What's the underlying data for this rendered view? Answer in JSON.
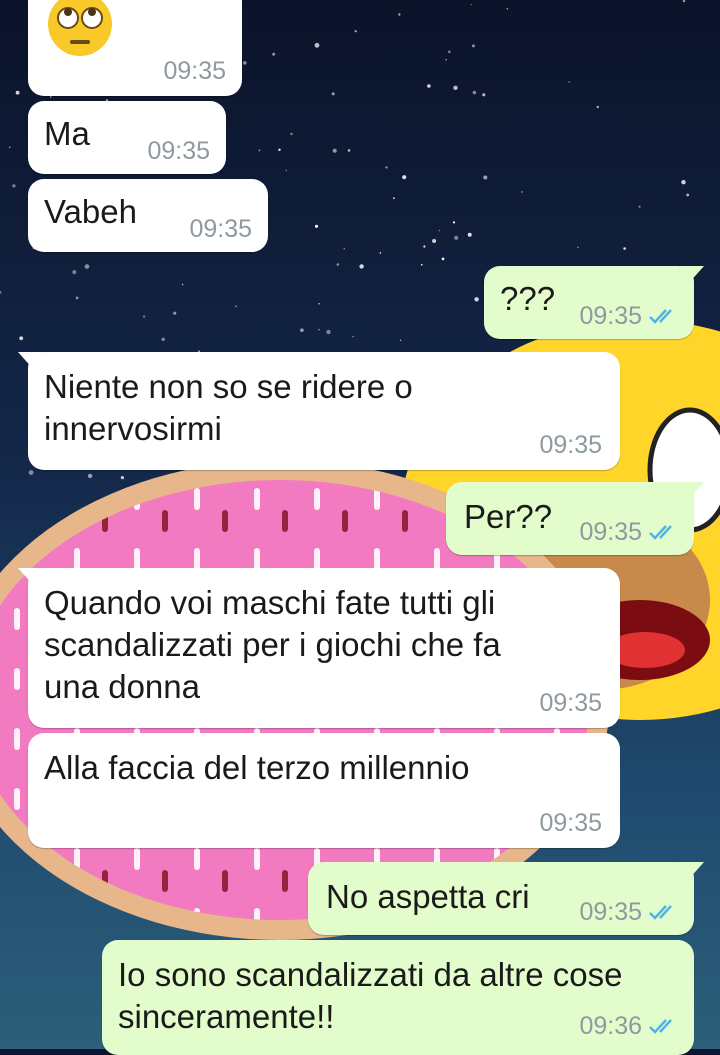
{
  "chat": {
    "messages": [
      {
        "direction": "incoming",
        "text": "🙄",
        "time": "09:35"
      },
      {
        "direction": "incoming",
        "text": "Ma",
        "time": "09:35"
      },
      {
        "direction": "incoming",
        "text": "Vabeh",
        "time": "09:35"
      },
      {
        "direction": "outgoing",
        "text": "???",
        "time": "09:35",
        "status": "read"
      },
      {
        "direction": "incoming",
        "text": "Niente non so se ridere o\ninnervosirmi",
        "time": "09:35"
      },
      {
        "direction": "outgoing",
        "text": "Per??",
        "time": "09:35",
        "status": "read"
      },
      {
        "direction": "incoming",
        "text": "Quando voi maschi fate tutti gli\nscandalizzati per i giochi che fa\nuna donna",
        "time": "09:35"
      },
      {
        "direction": "incoming",
        "text": "Alla faccia del terzo millennio",
        "time": "09:35"
      },
      {
        "direction": "outgoing",
        "text": "No aspetta cri",
        "time": "09:35",
        "status": "read"
      },
      {
        "direction": "outgoing",
        "text": "Io sono scandalizzati da altre cose\nsinceramente!!",
        "time": "09:36",
        "status": "read"
      }
    ]
  },
  "colors": {
    "incoming_bubble": "#ffffff",
    "outgoing_bubble": "#e2fdcb",
    "timestamp": "#8d9aa0",
    "read_ticks": "#4fb4e6",
    "wallpaper_space": "#0d1630"
  },
  "icons": {
    "emoji": "face-with-rolling-eyes",
    "read_receipt": "double-check-blue"
  }
}
